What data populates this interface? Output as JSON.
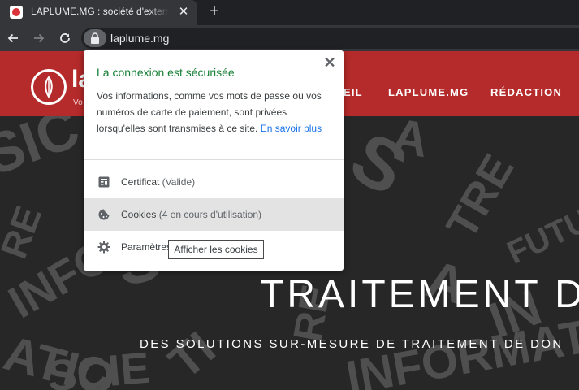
{
  "browser": {
    "tab_title": "LAPLUME.MG : société d'externalisation",
    "tab_close": "✕",
    "new_tab": "+",
    "url": "laplume.mg"
  },
  "site": {
    "logo_text": "la",
    "logo_sub": "Vo",
    "nav": [
      "EIL",
      "LAPLUME.MG",
      "RÉDACTION"
    ],
    "hero_title": "TRAITEMENT D",
    "hero_subtitle": "DES SOLUTIONS SUR-MESURE DE TRAITEMENT DE DON",
    "header_color": "#b52a2a"
  },
  "popup": {
    "close": "✕",
    "title": "La connexion est sécurisée",
    "body": "Vos informations, comme vos mots de passe ou vos numéros de carte de paiement, sont privées lorsqu'elles sont transmises à ce site. ",
    "link": "En savoir plus",
    "rows": [
      {
        "label": "Certificat",
        "detail": " (Valide)",
        "icon": "certificate-icon"
      },
      {
        "label": "Cookies",
        "detail": " (4 en cours d'utilisation)",
        "icon": "cookie-icon"
      },
      {
        "label": "Paramètres",
        "detail": "",
        "icon": "settings-gear-icon"
      }
    ],
    "tooltip": "Afficher les cookies",
    "title_color": "#188038",
    "link_color": "#1a73e8"
  }
}
